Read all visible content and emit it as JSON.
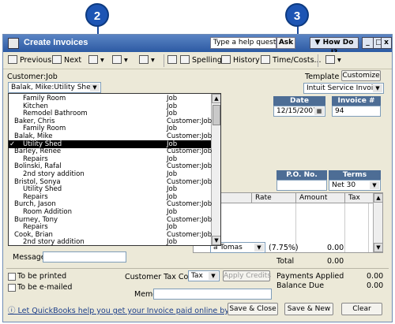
{
  "callouts": [
    "2",
    "3"
  ],
  "window": {
    "title": "Create Invoices",
    "help_placeholder": "Type a help question",
    "ask_label": "Ask",
    "how_do_i_label": "How Do I?",
    "min_btn": "_",
    "max_btn": "□",
    "close_btn": "x"
  },
  "toolbar": {
    "previous": "Previous",
    "next": "Next",
    "spelling": "Spelling",
    "history": "History",
    "time_costs": "Time/Costs..."
  },
  "customer": {
    "label": "Customer:Job",
    "value": "Balak, Mike:Utility Shed"
  },
  "template": {
    "label": "Template",
    "customize_label": "Customize",
    "value": "Intuit Service Invoice"
  },
  "invoice": {
    "date_label": "Date",
    "date_value": "12/15/2007",
    "number_label": "Invoice #",
    "number_value": "94",
    "po_label": "P.O. No.",
    "terms_label": "Terms",
    "terms_value": "Net 30"
  },
  "grid": {
    "columns": [
      "Rate",
      "Amount",
      "Tax"
    ]
  },
  "dropdown_items": [
    {
      "name": "Family Room",
      "type": "Job",
      "indent": 1,
      "selected": false
    },
    {
      "name": "Kitchen",
      "type": "Job",
      "indent": 1,
      "selected": false
    },
    {
      "name": "Remodel Bathroom",
      "type": "Job",
      "indent": 1,
      "selected": false
    },
    {
      "name": "Baker, Chris",
      "type": "Customer:Job",
      "indent": 0,
      "selected": false
    },
    {
      "name": "Family Room",
      "type": "Job",
      "indent": 1,
      "selected": false
    },
    {
      "name": "Balak, Mike",
      "type": "Customer:Job",
      "indent": 0,
      "selected": false
    },
    {
      "name": "Utility Shed",
      "type": "Job",
      "indent": 1,
      "selected": true
    },
    {
      "name": "Barley, Renee",
      "type": "Customer:Job",
      "indent": 0,
      "selected": false
    },
    {
      "name": "Repairs",
      "type": "Job",
      "indent": 1,
      "selected": false
    },
    {
      "name": "Bolinski, Rafal",
      "type": "Customer:Job",
      "indent": 0,
      "selected": false
    },
    {
      "name": "2nd story addition",
      "type": "Job",
      "indent": 1,
      "selected": false
    },
    {
      "name": "Bristol, Sonya",
      "type": "Customer:Job",
      "indent": 0,
      "selected": false
    },
    {
      "name": "Utility Shed",
      "type": "Job",
      "indent": 1,
      "selected": false
    },
    {
      "name": "Repairs",
      "type": "Job",
      "indent": 1,
      "selected": false
    },
    {
      "name": "Burch, Jason",
      "type": "Customer:Job",
      "indent": 0,
      "selected": false
    },
    {
      "name": "Room Addition",
      "type": "Job",
      "indent": 1,
      "selected": false
    },
    {
      "name": "Burney, Tony",
      "type": "Customer:Job",
      "indent": 0,
      "selected": false
    },
    {
      "name": "Repairs",
      "type": "Job",
      "indent": 1,
      "selected": false
    },
    {
      "name": "Cook, Brian",
      "type": "Customer:Job",
      "indent": 0,
      "selected": false
    },
    {
      "name": "2nd story addition",
      "type": "Job",
      "indent": 1,
      "selected": false
    }
  ],
  "checkmark": "✓",
  "tax": {
    "item_value": "a Tomas",
    "rate": "(7.75%)",
    "amount": "0.00"
  },
  "totals": {
    "total_label": "Total",
    "total_value": "0.00",
    "payments_label": "Payments Applied",
    "payments_value": "0.00",
    "balance_label": "Balance Due",
    "balance_value": "0.00"
  },
  "message_label": "Message",
  "print_label": "To be printed",
  "email_label": "To be e-mailed",
  "tax_code_label": "Customer Tax Code",
  "tax_code_value": "Tax",
  "apply_credits_label": "Apply Credits",
  "memo_label": "Memo",
  "promo_text": "Let QuickBooks help you get your Invoice paid online by credit card.",
  "buttons": {
    "save_close": "Save & Close",
    "save_new": "Save & New",
    "clear": "Clear"
  }
}
